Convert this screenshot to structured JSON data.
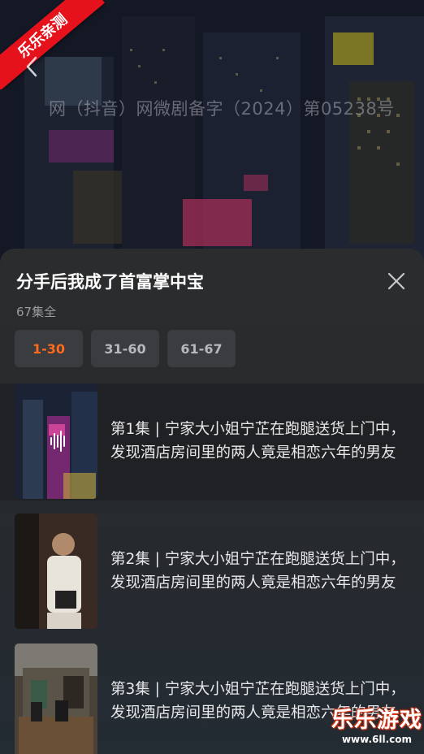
{
  "badge": "乐乐亲测",
  "license_text": "网（抖音）网微剧备字（2024）第05238号",
  "sheet": {
    "title": "分手后我成了首富掌中宝",
    "episode_count": "67集全",
    "tabs": [
      {
        "label": "1-30",
        "active": true
      },
      {
        "label": "31-60",
        "active": false
      },
      {
        "label": "61-67",
        "active": false
      }
    ]
  },
  "episodes": [
    {
      "text": "第1集 | 宁家大小姐宁芷在跑腿送货上门中，发现酒店房间里的两人竟是相恋六年的男友",
      "playing": true
    },
    {
      "text": "第2集 | 宁家大小姐宁芷在跑腿送货上门中，发现酒店房间里的两人竟是相恋六年的男友",
      "playing": false
    },
    {
      "text": "第3集 | 宁家大小姐宁芷在跑腿送货上门中，发现酒店房间里的两人竟是相恋六年的男友",
      "playing": false
    }
  ],
  "watermark": {
    "main": "乐乐游戏",
    "sub": "www.6ll.com"
  },
  "colors": {
    "accent": "#ff6a1f",
    "badge": "#e5121c",
    "sheet_bg": "#2b2c2e"
  }
}
